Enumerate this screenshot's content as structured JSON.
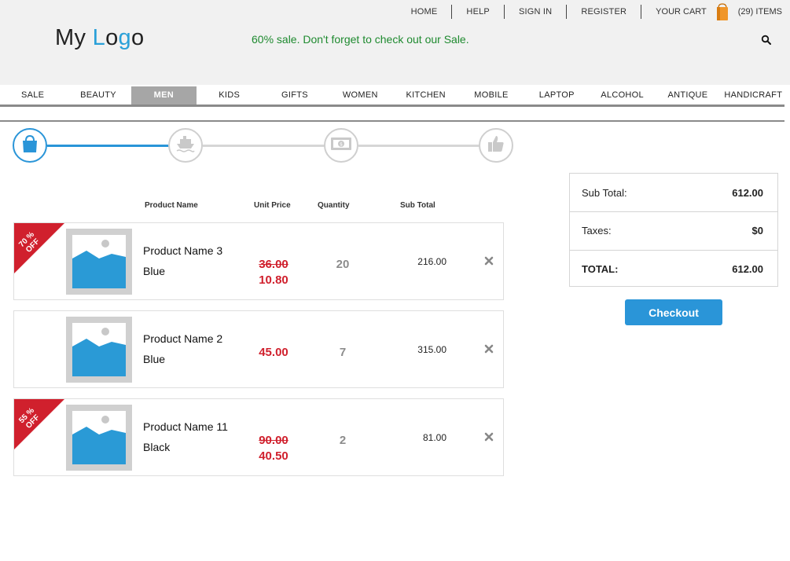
{
  "toplinks": {
    "home": "HOME",
    "help": "HELP",
    "sign_in": "SIGN IN",
    "register": "REGISTER",
    "your_cart": "YOUR CART",
    "items": "(29) ITEMS",
    "cart_icon": "shopping-bag-icon"
  },
  "logo": {
    "part1": "My ",
    "part2": "L",
    "part3": "o",
    "part4": "g",
    "part5": "o"
  },
  "promo": "60% sale. Don't forget to check out our Sale.",
  "nav": {
    "items": [
      "SALE",
      "BEAUTY",
      "MEN",
      "KIDS",
      "GIFTS",
      "WOMEN",
      "KITCHEN",
      "MOBILE",
      "LAPTOP",
      "ALCOHOL",
      "ANTIQUE",
      "HANDICRAFT"
    ],
    "active": "MEN"
  },
  "steps": {
    "icons": [
      "shopping-bag-icon",
      "ship-icon",
      "banknote-icon",
      "thumbs-up-icon"
    ],
    "active_step": 1,
    "colors": {
      "active": "#2a95d8",
      "inactive": "#cfcfcf"
    }
  },
  "table": {
    "headers": {
      "name": "Product Name",
      "price": "Unit Price",
      "qty": "Quantity",
      "subtotal": "Sub Total"
    },
    "rows": [
      {
        "badge": "70 % OFF",
        "name": "Product Name 3",
        "color": "Blue",
        "old_price": "36.00",
        "price": "10.80",
        "qty": "20",
        "subtotal": "216.00"
      },
      {
        "badge": "",
        "name": "Product Name 2",
        "color": "Blue",
        "old_price": "",
        "price": "45.00",
        "qty": "7",
        "subtotal": "315.00"
      },
      {
        "badge": "55 % OFF",
        "name": "Product Name 11",
        "color": "Black",
        "old_price": "90.00",
        "price": "40.50",
        "qty": "2",
        "subtotal": "81.00"
      }
    ]
  },
  "summary": {
    "subtotal_label": "Sub Total:",
    "subtotal_value": "612.00",
    "taxes_label": "Taxes:",
    "taxes_value": "$0",
    "total_label": "TOTAL:",
    "total_value": "612.00"
  },
  "checkout_label": "Checkout",
  "colors": {
    "accent": "#2a95d8",
    "sale_red": "#d0202d",
    "promo_green": "#1e8a2f"
  }
}
